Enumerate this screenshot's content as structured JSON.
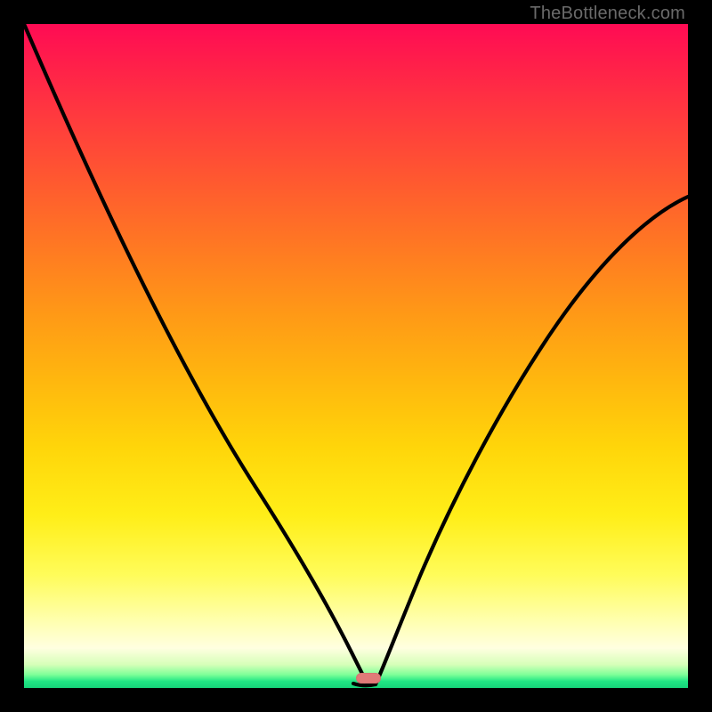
{
  "attribution": "TheBottleneck.com",
  "marker": {
    "cx_frac": 0.519,
    "cy_frac": 0.985
  },
  "chart_data": {
    "type": "line",
    "title": "",
    "xlabel": "",
    "ylabel": "",
    "xlim": [
      0,
      1
    ],
    "ylim": [
      0,
      1
    ],
    "series": [
      {
        "name": "left-branch",
        "x": [
          0.0,
          0.05,
          0.1,
          0.15,
          0.2,
          0.25,
          0.3,
          0.35,
          0.4,
          0.43,
          0.46,
          0.48,
          0.5,
          0.51
        ],
        "y": [
          1.0,
          0.88,
          0.77,
          0.66,
          0.56,
          0.46,
          0.37,
          0.28,
          0.19,
          0.13,
          0.075,
          0.04,
          0.015,
          0.005
        ]
      },
      {
        "name": "right-branch",
        "x": [
          0.53,
          0.55,
          0.58,
          0.62,
          0.67,
          0.73,
          0.8,
          0.87,
          0.93,
          1.0
        ],
        "y": [
          0.008,
          0.03,
          0.08,
          0.15,
          0.24,
          0.35,
          0.47,
          0.58,
          0.66,
          0.74
        ]
      }
    ],
    "optimum_marker": {
      "x": 0.519,
      "y": 0.0
    }
  }
}
